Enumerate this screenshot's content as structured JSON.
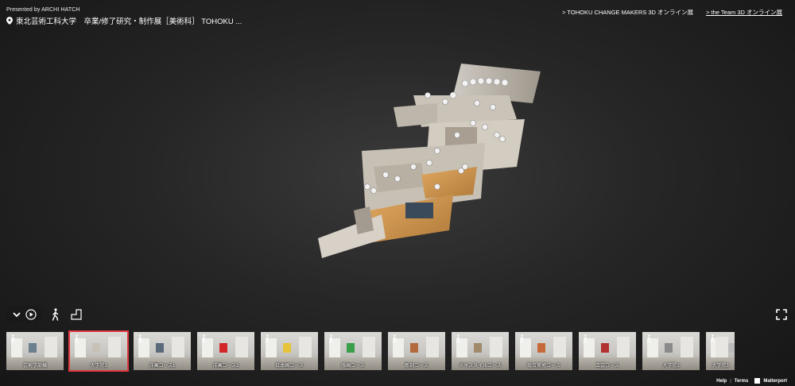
{
  "header": {
    "presented_by": "Presented by ARCHI HATCH",
    "title": "東北芸術工科大学　卒業/修了研究・制作展［美術科］ TOHOKU ..."
  },
  "top_links": [
    {
      "label": "> TOHOKU CHANGE MAKERS 3D オンライン展",
      "underline": false
    },
    {
      "label": "> the Team 3D オンライン展",
      "underline": true
    }
  ],
  "controls": {
    "icons": [
      "chevron-down-icon",
      "play-icon",
      "walk-icon",
      "floorplan-icon",
      "fullscreen-icon"
    ]
  },
  "thumbnails": [
    {
      "label": "芸術学部棟",
      "active": false,
      "art": "#6b7f8f"
    },
    {
      "label": "大学院1",
      "active": true,
      "art": "#c7c2b8"
    },
    {
      "label": "洋画コース1",
      "active": false,
      "art": "#5a6a7a"
    },
    {
      "label": "洋画コース2",
      "active": false,
      "art": "#d4262a"
    },
    {
      "label": "日本画コース",
      "active": false,
      "art": "#e6c33a"
    },
    {
      "label": "版画コース",
      "active": false,
      "art": "#3a9e4a"
    },
    {
      "label": "彫刻コース",
      "active": false,
      "art": "#b46a3c"
    },
    {
      "label": "テキスタイルコース",
      "active": false,
      "art": "#a08a6a"
    },
    {
      "label": "総合美術コース",
      "active": false,
      "art": "#c76a3a"
    },
    {
      "label": "工芸コース",
      "active": false,
      "art": "#b23030"
    },
    {
      "label": "大学院2",
      "active": false,
      "art": "#8a8a8a"
    },
    {
      "label": "大学院3",
      "active": false,
      "art": "#bbbbbb"
    }
  ],
  "footer": {
    "help": "Help",
    "terms": "Terms",
    "brand": "Matterport",
    "separator": "|"
  },
  "colors": {
    "accent": "#e0393f",
    "background": "#262626"
  }
}
